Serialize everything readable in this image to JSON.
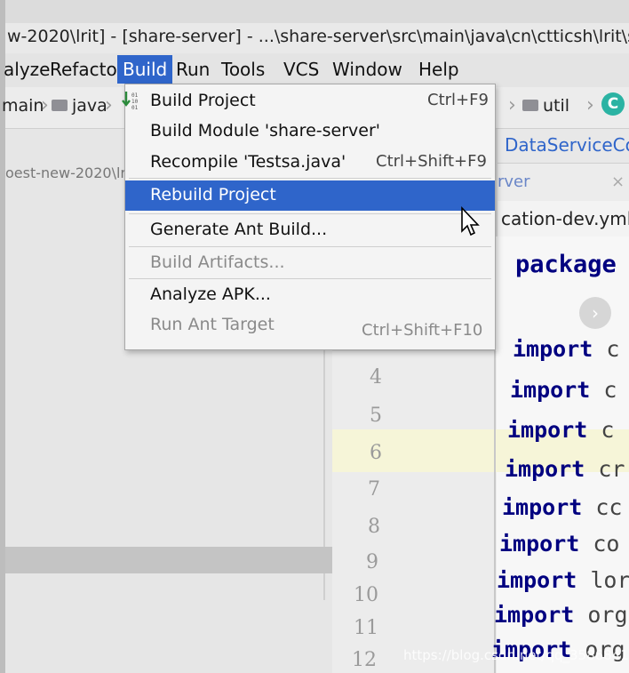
{
  "window": {
    "title": "w-2020\\lrit] - [share-server] - ...\\share-server\\src\\main\\java\\cn\\ctticsh\\lrit\\shar"
  },
  "menubar": {
    "items": [
      {
        "label": "alyze"
      },
      {
        "label": "Refactor"
      },
      {
        "label": "Build"
      },
      {
        "label": "Run"
      },
      {
        "label": "Tools"
      },
      {
        "label": "VCS"
      },
      {
        "label": "Window"
      },
      {
        "label": "Help"
      }
    ]
  },
  "breadcrumb": {
    "items": [
      {
        "label": "main",
        "icon": "folder-icon"
      },
      {
        "label": "java",
        "icon": "folder-icon"
      },
      {
        "label": "util",
        "icon": "folder-icon"
      }
    ],
    "class_icon_glyph": "C"
  },
  "project_panel": {
    "path_text": "oest-new-2020\\lrit"
  },
  "build_menu": {
    "items": [
      {
        "label": "Build Project",
        "shortcut": "Ctrl+F9",
        "enabled": true,
        "selected": false
      },
      {
        "label": "Build Module 'share-server'",
        "shortcut": "",
        "enabled": true,
        "selected": false
      },
      {
        "label": "Recompile 'Testsa.java'",
        "shortcut": "Ctrl+Shift+F9",
        "enabled": true,
        "selected": false
      },
      {
        "label": "Rebuild Project",
        "shortcut": "",
        "enabled": true,
        "selected": true
      },
      {
        "label": "Generate Ant Build...",
        "shortcut": "",
        "enabled": true,
        "selected": false
      },
      {
        "label": "Build Artifacts...",
        "shortcut": "",
        "enabled": false,
        "selected": false
      },
      {
        "label": "Analyze APK...",
        "shortcut": "",
        "enabled": true,
        "selected": false
      },
      {
        "label": "Run Ant Target",
        "shortcut": "Ctrl+Shift+F10",
        "enabled": false,
        "selected": false
      }
    ]
  },
  "editor_tabs": {
    "tab1": "DataServiceCo",
    "tab2": "rver",
    "tab2_close": "×",
    "tab3": "cation-dev.yml"
  },
  "editor": {
    "package_keyword": "package",
    "arrow_glyph": "›",
    "line_numbers": [
      "4",
      "5",
      "6",
      "7",
      "8",
      "9",
      "10",
      "11",
      "12"
    ],
    "lines": [
      {
        "kw": "import",
        "rest": "c"
      },
      {
        "kw": "import",
        "rest": "c"
      },
      {
        "kw": "import",
        "rest": "c"
      },
      {
        "kw": "import",
        "rest": "cr"
      },
      {
        "kw": "import",
        "rest": "cc"
      },
      {
        "kw": "import",
        "rest": "co"
      },
      {
        "kw": "import",
        "rest": "lor"
      },
      {
        "kw": "import",
        "rest": "org"
      },
      {
        "kw": "import",
        "rest": "org"
      }
    ]
  },
  "watermark": "https://blog.csdn.net/qq_35868412",
  "colors": {
    "accent": "#2f65ca",
    "keyword": "#000080",
    "highlight_row": "#f6f5d8"
  }
}
